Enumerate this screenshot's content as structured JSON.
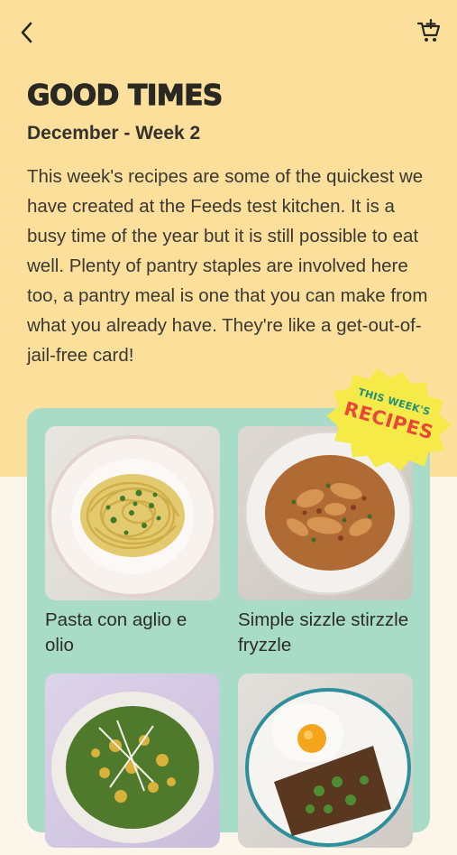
{
  "header": {
    "back_icon": "chevron-left-icon",
    "cart_icon": "add-to-cart-icon"
  },
  "page": {
    "title": "GOOD TIMES",
    "subtitle": "December - Week 2",
    "description": "This week's recipes are some of the quickest we have created at the Feeds test kitchen. It is a busy time of the year but it is still possible to eat well. Plenty of pantry staples are involved here too, a pantry meal is one that you can make from what you already have. They're like a get-out-of-jail-free card!"
  },
  "badge": {
    "line1": "THIS WEEK'S",
    "line2": "RECIPES"
  },
  "recipes": [
    {
      "name": "Pasta con aglio e olio"
    },
    {
      "name": "Simple sizzle stirzzle fryzzle"
    },
    {
      "name": ""
    },
    {
      "name": ""
    }
  ],
  "colors": {
    "hero_bg": "#fbdf9b",
    "card_bg": "#a8dbc8",
    "page_bg": "#fcf5e9",
    "badge_bg": "#f6ea49",
    "badge_accent": "#e9473a",
    "badge_teal": "#1f8f7a"
  }
}
